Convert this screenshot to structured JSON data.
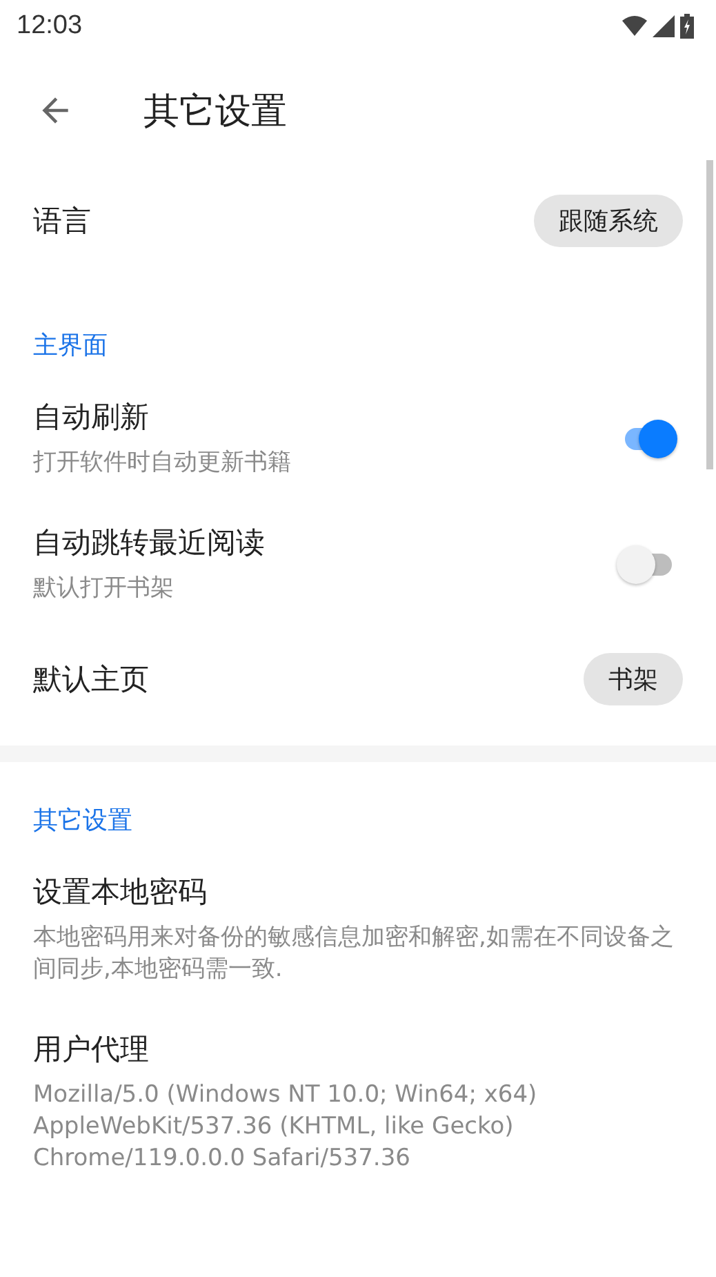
{
  "status_bar": {
    "time": "12:03"
  },
  "toolbar": {
    "title": "其它设置"
  },
  "sections": [
    {
      "items": [
        {
          "kind": "value",
          "title": "语言",
          "value": "跟随系统"
        }
      ]
    },
    {
      "header": "主界面",
      "items": [
        {
          "kind": "switch",
          "title": "自动刷新",
          "summary": "打开软件时自动更新书籍",
          "on": true
        },
        {
          "kind": "switch",
          "title": "自动跳转最近阅读",
          "summary": "默认打开书架",
          "on": false
        },
        {
          "kind": "value",
          "title": "默认主页",
          "value": "书架"
        }
      ]
    },
    {
      "header": "其它设置",
      "items": [
        {
          "kind": "text",
          "title": "设置本地密码",
          "summary": "本地密码用来对备份的敏感信息加密和解密,如需在不同设备之间同步,本地密码需一致."
        },
        {
          "kind": "text",
          "title": "用户代理",
          "summary": "Mozilla/5.0 (Windows NT 10.0; Win64; x64) AppleWebKit/537.36 (KHTML, like Gecko) Chrome/119.0.0.0 Safari/537.36"
        }
      ]
    }
  ]
}
